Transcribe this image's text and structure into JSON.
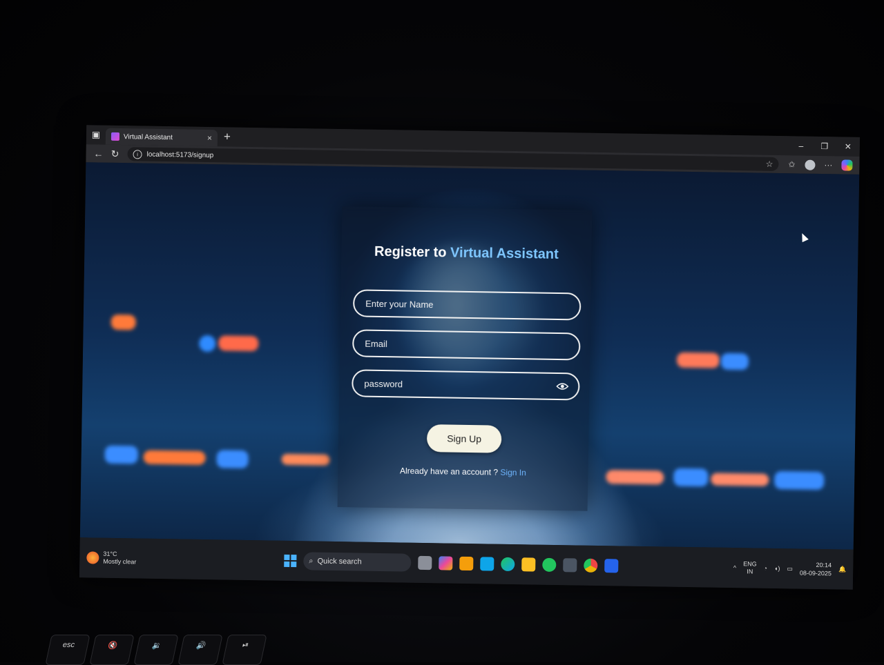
{
  "browser": {
    "tab_title": "Virtual Assistant",
    "tab_close": "×",
    "new_tab": "+",
    "url": "localhost:5173/signup",
    "win_minimize": "–",
    "win_restore": "❐",
    "win_close": "✕"
  },
  "signup": {
    "title_prefix": "Register to ",
    "title_accent": "Virtual Assistant",
    "name_placeholder": "Enter your Name",
    "email_placeholder": "Email",
    "password_placeholder": "password",
    "submit_label": "Sign Up",
    "already_text": "Already have an account ? ",
    "signin_link": "Sign In"
  },
  "taskbar": {
    "weather_temp": "31°C",
    "weather_desc": "Mostly clear",
    "search_placeholder": "Quick search",
    "lang_top": "ENG",
    "lang_bottom": "IN",
    "time": "20:14",
    "date": "08-09-2025"
  },
  "keyboard": {
    "keys": [
      "esc",
      "🔇",
      "🔉",
      "🔊",
      "⏯"
    ]
  },
  "colors": {
    "accent": "#7fc7ff",
    "link": "#6fb6ff",
    "button_bg": "#f5f3e3"
  }
}
